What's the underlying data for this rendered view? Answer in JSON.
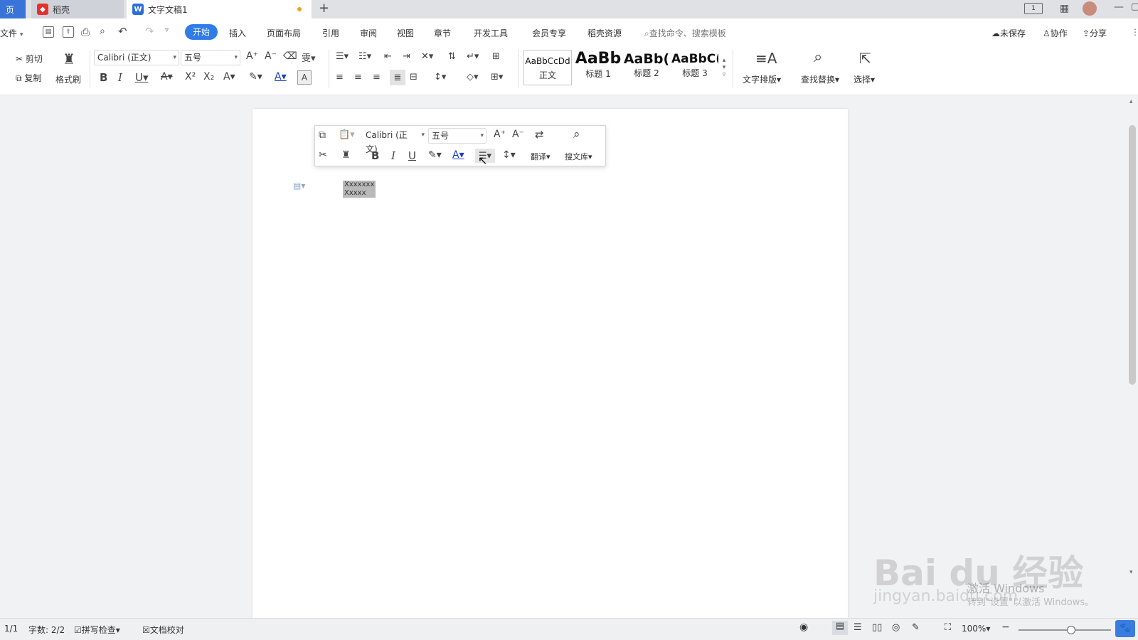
{
  "tabs": {
    "home": "页",
    "daoke": "稻壳",
    "doc": "文字文稿1",
    "new": "+"
  },
  "menu": {
    "file": "文件",
    "items": [
      "开始",
      "插入",
      "页面布局",
      "引用",
      "审阅",
      "视图",
      "章节",
      "开发工具",
      "会员专享",
      "稻壳资源"
    ],
    "search_placeholder": "查找命令、搜索模板",
    "unsaved": "未保存",
    "collab": "协作",
    "share": "分享"
  },
  "ribbon": {
    "cut": "剪切",
    "copy": "复制",
    "format_painter": "格式刷",
    "font": "Calibri (正文)",
    "size": "五号",
    "styles": [
      {
        "preview": "AaBbCcDd",
        "name": "正文"
      },
      {
        "preview": "AaBb",
        "name": "标题 1"
      },
      {
        "preview": "AaBb(",
        "name": "标题 2"
      },
      {
        "preview": "AaBbC(",
        "name": "标题 3"
      }
    ],
    "text_layout": "文字排版",
    "find_replace": "查找替换",
    "select": "选择"
  },
  "mini_toolbar": {
    "font": "Calibri (正文)",
    "size": "五号",
    "translate": "翻译",
    "search_library": "搜文库"
  },
  "document": {
    "lines": [
      "Xxxxxxx",
      "Xxxxx"
    ]
  },
  "status": {
    "page": "1/1",
    "word_count": "字数: 2/2",
    "spell_check": "拼写检查",
    "doc_proof": "文档校对",
    "zoom": "100%"
  },
  "watermark": {
    "brand": "Bai  du 经验",
    "url": "jingyan.baidu.com",
    "activate": "激活 Windows",
    "activate_sub": "转到\"设置\"以激活 Windows。"
  },
  "colors": {
    "accent": "#2f7ce6",
    "tab_bar": "#dfe1e5",
    "font_color_bar": "#1a3cc8",
    "selection": "#b9b9b9"
  }
}
